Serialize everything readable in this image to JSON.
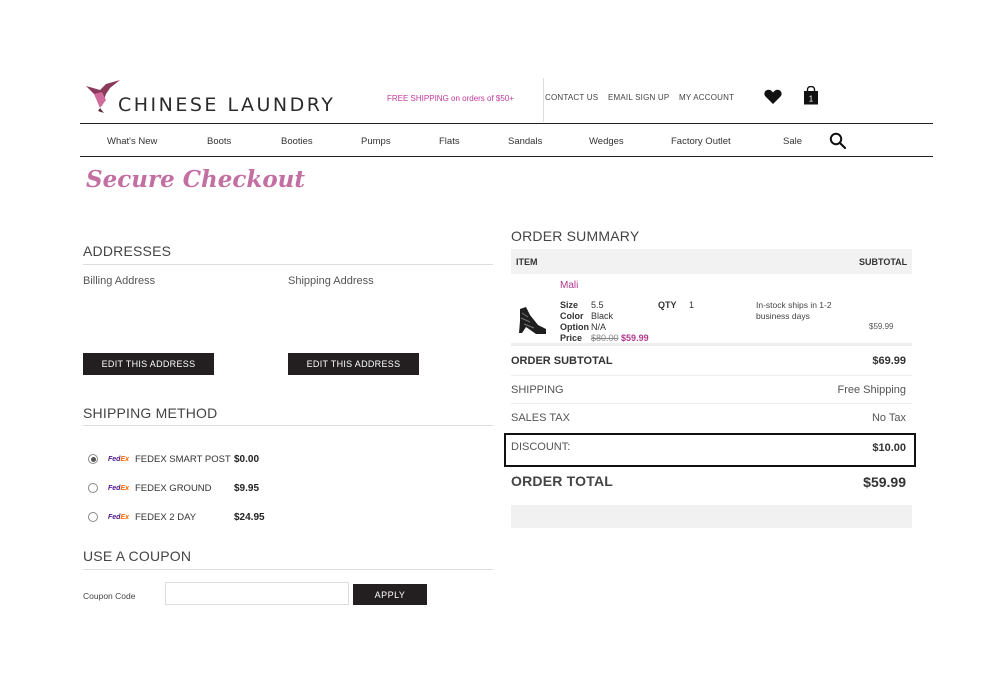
{
  "header": {
    "logo_text": "CHINESE LAUNDRY",
    "promo": "FREE SHIPPING on orders of $50+",
    "links": [
      "CONTACT US",
      "EMAIL SIGN UP",
      "MY ACCOUNT"
    ],
    "cart_count": "1",
    "search_icon": "search-icon",
    "heart_icon": "heart-icon",
    "bag_icon": "shopping-bag-icon"
  },
  "nav": [
    "What's New",
    "Boots",
    "Booties",
    "Pumps",
    "Flats",
    "Sandals",
    "Wedges",
    "Factory Outlet",
    "Sale"
  ],
  "page_title": "Secure Checkout",
  "addresses": {
    "heading": "ADDRESSES",
    "billing_label": "Billing Address",
    "shipping_label": "Shipping Address",
    "edit_billing": "EDIT THIS ADDRESS",
    "edit_shipping": "EDIT THIS ADDRESS"
  },
  "shipping_method": {
    "heading": "SHIPPING METHOD",
    "carrier_fe": "Fed",
    "carrier_ex": "Ex",
    "options": [
      {
        "name": "FEDEX SMART POST",
        "price": "$0.00",
        "selected": true
      },
      {
        "name": "FEDEX GROUND",
        "price": "$9.95",
        "selected": false
      },
      {
        "name": "FEDEX 2 DAY",
        "price": "$24.95",
        "selected": false
      }
    ]
  },
  "coupon": {
    "heading": "USE A COUPON",
    "label": "Coupon Code",
    "value": "",
    "apply": "APPLY"
  },
  "order_summary": {
    "heading": "ORDER SUMMARY",
    "col_item": "ITEM",
    "col_subtotal": "SUBTOTAL",
    "item": {
      "name": "Mali",
      "size_label": "Size",
      "size": "5.5",
      "color_label": "Color",
      "color": "Black",
      "option_label": "Option",
      "option": "N/A",
      "price_label": "Price",
      "original_price": "$80.00",
      "sale_price": "$59.99",
      "qty_label": "QTY",
      "qty": "1",
      "stock": "In-stock ships in 1-2 business days",
      "line_total": "$59.99"
    },
    "subtotal_label": "ORDER SUBTOTAL",
    "subtotal": "$69.99",
    "shipping_label": "SHIPPING",
    "shipping": "Free Shipping",
    "tax_label": "SALES TAX",
    "tax": "No Tax",
    "discount_label": "DISCOUNT:",
    "discount": "$10.00",
    "total_label": "ORDER TOTAL",
    "total": "$59.99"
  }
}
